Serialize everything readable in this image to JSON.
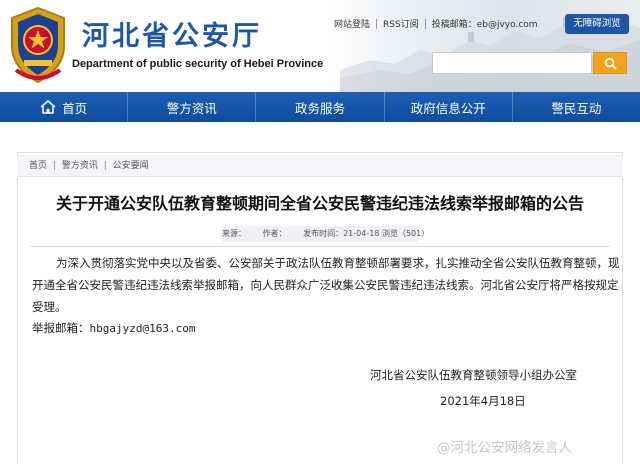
{
  "header": {
    "site_title": "河北省公安厅",
    "site_subtitle": "Department of public security of Hebei Province",
    "toplinks": [
      "网站登陆",
      "RSS订阅",
      "投稿邮箱：eb@jvyo.com"
    ],
    "accessibility_button": "无障碍浏览",
    "brand_blue": "#1d57a6",
    "search_button_color": "#f0a31c"
  },
  "nav": {
    "items": [
      "首页",
      "警方资讯",
      "政务服务",
      "政府信息公开",
      "警民互动"
    ]
  },
  "breadcrumb": [
    "首页",
    "警方资讯",
    "公安要闻"
  ],
  "article": {
    "title": "关于开通公安队伍教育整顿期间全省公安民警违纪违法线索举报邮箱的公告",
    "meta_source_label": "来源：",
    "meta_author_label": "作者：",
    "meta_date": "发布时间：21-04-18",
    "meta_views": "浏览（501）",
    "body": "为深入贯彻落实党中央以及省委、公安部关于政法队伍教育整顿部署要求，扎实推动全省公安队伍教育整顿，现开通全省公安民警违纪违法线索举报邮箱，向人民群众广泛收集公安民警违纪违法线索。河北省公安厅将严格按规定受理。",
    "email_label": "举报邮箱：",
    "email_address": "hbgajyzd@163.com",
    "signature": "河北省公安队伍教育整顿领导小组办公室",
    "signature_date": "2021年4月18日"
  },
  "watermark": "@河北公安网络发言人"
}
